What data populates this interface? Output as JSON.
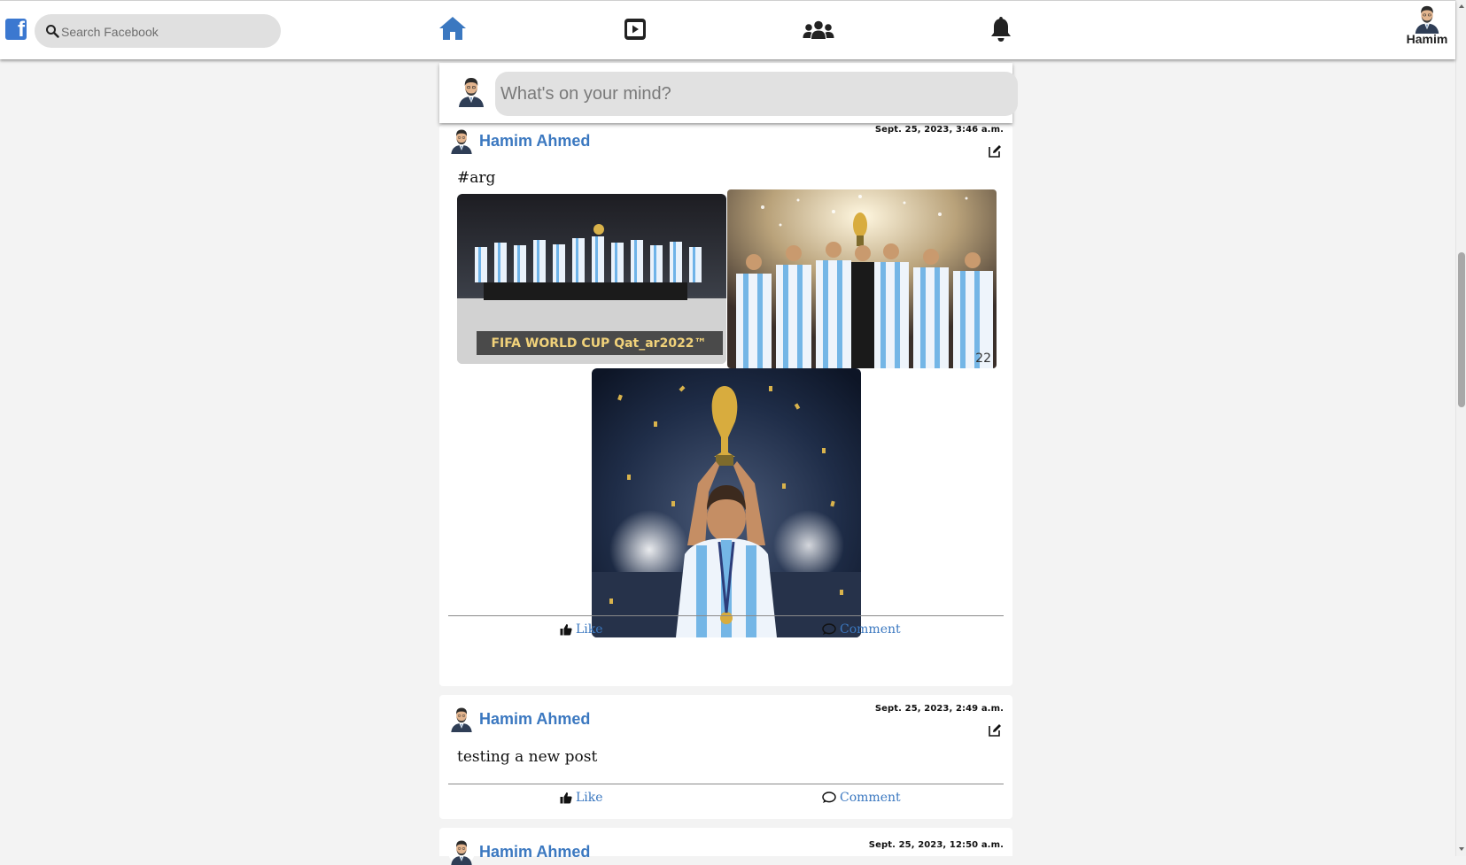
{
  "header": {
    "logo_glyph": "f",
    "search_placeholder": "Search Facebook",
    "profile_name": "Hamim",
    "icons": [
      "home-icon",
      "video-icon",
      "groups-icon",
      "bell-icon"
    ],
    "accent": "#3b78c0"
  },
  "composer": {
    "placeholder": "What's on your mind?"
  },
  "posts": [
    {
      "author": "Hamim Ahmed",
      "timestamp": "Sept. 25, 2023, 3:46 a.m.",
      "text": "#arg",
      "photos": [
        {
          "caption": "FIFA WORLD CUP Qat_ar2022™"
        },
        {
          "jersey_number": "22"
        },
        {}
      ],
      "like_label": "Like",
      "comment_label": "Comment"
    },
    {
      "author": "Hamim Ahmed",
      "timestamp": "Sept. 25, 2023, 2:49 a.m.",
      "text": "testing a new post",
      "like_label": "Like",
      "comment_label": "Comment"
    },
    {
      "author": "Hamim Ahmed",
      "timestamp": "Sept. 25, 2023, 12:50 a.m."
    }
  ]
}
